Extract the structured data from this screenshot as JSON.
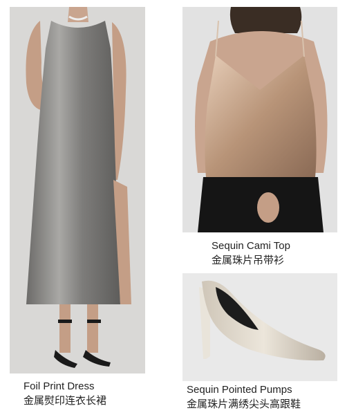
{
  "products": [
    {
      "id": "dress",
      "name_en": "Foil Print Dress",
      "name_cn": "金属熨印连衣长裙",
      "colors": {
        "accent": "#8d8c8a",
        "background": "#d9d8d6"
      }
    },
    {
      "id": "cami",
      "name_en": "Sequin Cami Top",
      "name_cn": "金属珠片吊带衫",
      "colors": {
        "accent": "#c9a88e",
        "background": "#e2e2e2"
      }
    },
    {
      "id": "pumps",
      "name_en": "Sequin Pointed Pumps",
      "name_cn": "金属珠片满绣尖头高跟鞋",
      "colors": {
        "accent": "#d6cfc2",
        "background": "#e9e9e9"
      }
    }
  ]
}
